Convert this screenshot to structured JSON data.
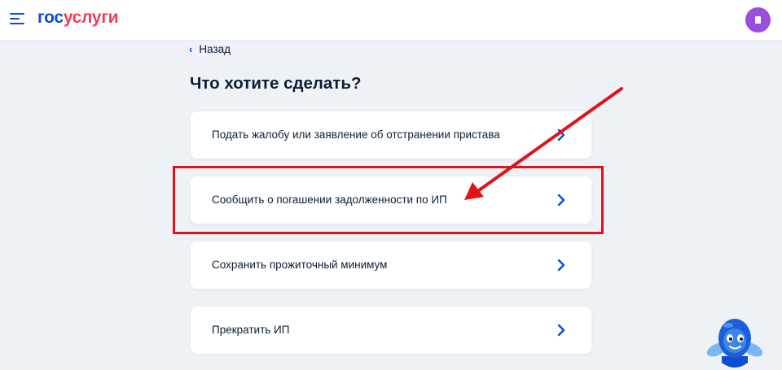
{
  "header": {
    "logo_part1": "гос",
    "logo_part2": "услуги",
    "menu_icon": "burger-menu-icon",
    "avatar_icon": "user-avatar-icon"
  },
  "back": {
    "label": "Назад",
    "icon": "chevron-left-icon"
  },
  "page": {
    "title": "Что хотите сделать?"
  },
  "options": [
    {
      "label": "Подать жалобу или заявление об отстранении пристава"
    },
    {
      "label": "Сообщить о погашении задолженности по ИП"
    },
    {
      "label": "Сохранить прожиточный минимум"
    },
    {
      "label": "Прекратить ИП"
    }
  ],
  "annotation": {
    "highlight_color": "#e0121a",
    "highlighted_option": "Сообщить о погашении задолженности по ИП"
  },
  "colors": {
    "brand_blue": "#0d4cd3",
    "brand_red": "#ee3f58",
    "background": "#eef2f7",
    "avatar": "#9b4dde"
  },
  "assistant": {
    "icon": "robot-assistant-icon"
  }
}
